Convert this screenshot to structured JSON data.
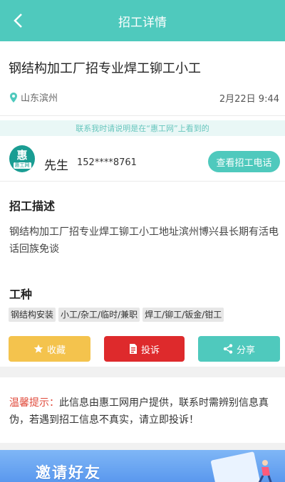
{
  "header": {
    "title": "招工详情",
    "back_icon": "chevron-left-icon"
  },
  "job": {
    "title": "钢结构加工厂招专业焊工铆工小工",
    "location": "山东滨州",
    "date": "2月22日 9:44"
  },
  "notice": "联系我时请说明是在“惠工网”上看到的",
  "contact": {
    "avatar_char": "惠",
    "avatar_sub": "惠工网",
    "name": "先生",
    "phone": "152****8761",
    "call_button": "查看招工电话"
  },
  "description": {
    "heading": "招工描述",
    "text": "钢结构加工厂招专业焊工铆工小工地址滨州博兴县长期有活电话回族免谈"
  },
  "trade": {
    "heading": "工种",
    "tags": [
      "钢结构安装",
      "小工/杂工/临时/兼职",
      "焊工/铆工/钣金/钳工"
    ]
  },
  "actions": {
    "favorite": "收藏",
    "report": "投诉",
    "share": "分享"
  },
  "tip": {
    "label": "温馨提示：",
    "text": "此信息由惠工网用户提供，联系时需辨别信息真伪，若遇到招工信息不真实，请立即投诉！"
  },
  "banner": {
    "text": "邀请好友"
  },
  "colors": {
    "accent": "#4fc9bd",
    "favorite": "#f4c34d",
    "report": "#de2a2c",
    "tip_label": "#e04a3b"
  }
}
